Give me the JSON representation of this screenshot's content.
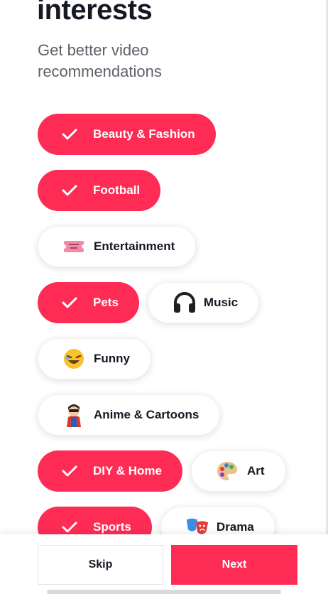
{
  "header": {
    "title": "interests",
    "subtitle": "Get better video recommendations"
  },
  "interests": [
    {
      "label": "Beauty & Fashion",
      "selected": true,
      "icon": "check-icon"
    },
    {
      "label": "Football",
      "selected": true,
      "icon": "check-icon"
    },
    {
      "label": "Entertainment",
      "selected": false,
      "icon": "ticket-icon"
    },
    {
      "label": "Pets",
      "selected": true,
      "icon": "check-icon"
    },
    {
      "label": "Music",
      "selected": false,
      "icon": "headphones-icon"
    },
    {
      "label": "Funny",
      "selected": false,
      "icon": "laughing-face-icon"
    },
    {
      "label": "Anime & Cartoons",
      "selected": false,
      "icon": "superhero-icon"
    },
    {
      "label": "DIY & Home",
      "selected": true,
      "icon": "check-icon"
    },
    {
      "label": "Art",
      "selected": false,
      "icon": "palette-icon"
    },
    {
      "label": "Sports",
      "selected": true,
      "icon": "check-icon"
    },
    {
      "label": "Drama",
      "selected": false,
      "icon": "theater-masks-icon"
    }
  ],
  "footer": {
    "skip_label": "Skip",
    "next_label": "Next"
  },
  "colors": {
    "accent": "#fe2c55",
    "text": "#161823",
    "subtext": "#5f6068"
  }
}
